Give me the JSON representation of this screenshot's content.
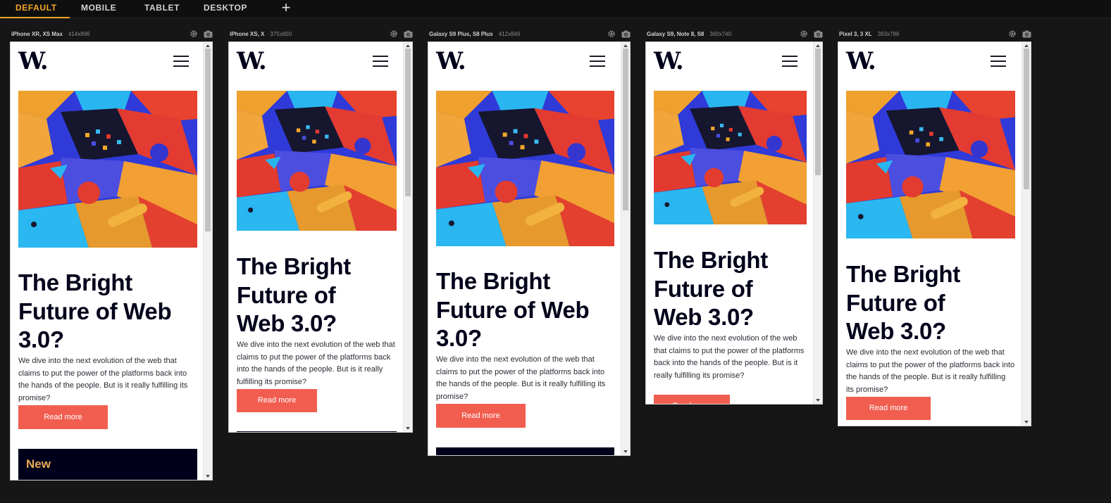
{
  "tabs": [
    {
      "label": "DEFAULT",
      "active": true
    },
    {
      "label": "MOBILE",
      "active": false
    },
    {
      "label": "TABLET",
      "active": false
    },
    {
      "label": "DESKTOP",
      "active": false
    }
  ],
  "add_tab_symbol": "+",
  "accent_color": "#f5a623",
  "page": {
    "logo": "W.",
    "headline": "The Bright Future of Web 3.0?",
    "description": "We dive into the next evolution of the web that claims to put the power of the platforms back into the hands of the people. But is it really fulfilling its promise?",
    "cta_label": "Read more",
    "new_label": "New",
    "cta_color": "#f15e50",
    "dark_color": "#00001a"
  },
  "devices": [
    {
      "name": "iPhone XR, XS Max",
      "size": "414x896"
    },
    {
      "name": "iPhone XS, X",
      "size": "375x800"
    },
    {
      "name": "Galaxy S9 Plus, S8 Plus",
      "size": "412x846"
    },
    {
      "name": "Galaxy S9, Note 8, S8",
      "size": "360x740"
    },
    {
      "name": "Pixel 3, 3 XL",
      "size": "393x786"
    }
  ],
  "device_icons": [
    "settings-icon",
    "camera-icon"
  ]
}
